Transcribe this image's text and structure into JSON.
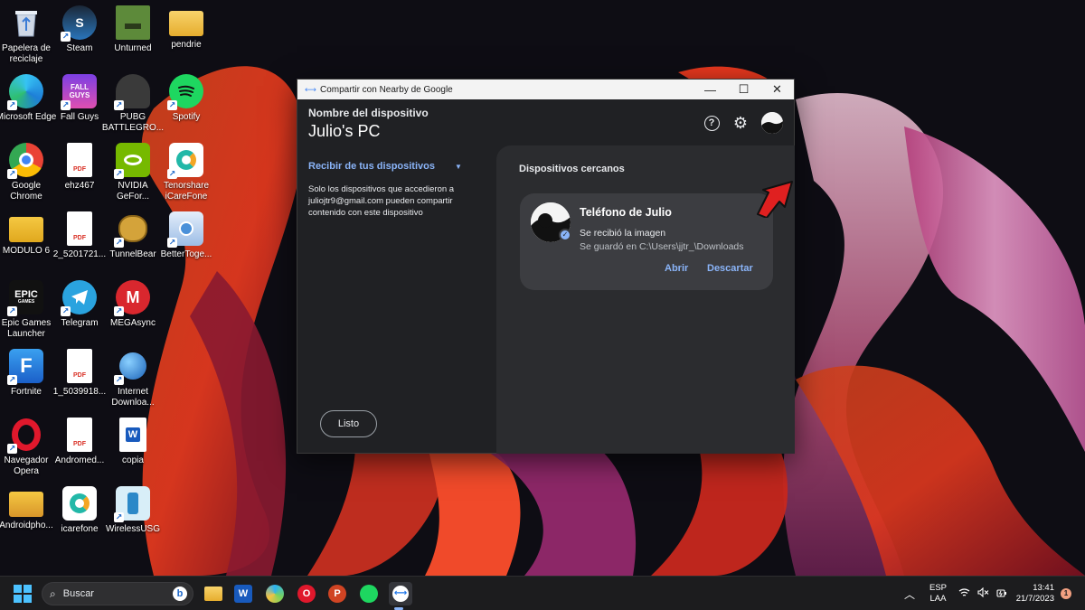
{
  "desktop": {
    "icons": [
      {
        "label": "Papelera de reciclaje",
        "icon": "recycle-bin-icon"
      },
      {
        "label": "Steam",
        "icon": "steam-icon"
      },
      {
        "label": "Unturned",
        "icon": "unturned-icon"
      },
      {
        "label": "pendrie",
        "icon": "folder-icon"
      },
      {
        "label": "Microsoft Edge",
        "icon": "edge-icon"
      },
      {
        "label": "Fall Guys",
        "icon": "fall-guys-icon"
      },
      {
        "label": "PUBG BATTLEGRO...",
        "icon": "pubg-icon"
      },
      {
        "label": "Spotify",
        "icon": "spotify-icon"
      },
      {
        "label": "Google Chrome",
        "icon": "chrome-icon"
      },
      {
        "label": "ehz467",
        "icon": "pdf-icon"
      },
      {
        "label": "NVIDIA GeFor...",
        "icon": "nvidia-icon"
      },
      {
        "label": "Tenorshare iCareFone",
        "icon": "icarefone-icon"
      },
      {
        "label": "MODULO 6",
        "icon": "folder-icon"
      },
      {
        "label": "2_5201721...",
        "icon": "pdf-icon"
      },
      {
        "label": "TunnelBear",
        "icon": "tunnelbear-icon"
      },
      {
        "label": "BetterToge...",
        "icon": "bettertogether-icon"
      },
      {
        "label": "Epic Games Launcher",
        "icon": "epic-games-icon"
      },
      {
        "label": "Telegram",
        "icon": "telegram-icon"
      },
      {
        "label": "MEGAsync",
        "icon": "mega-icon"
      },
      {
        "label": "Fortnite",
        "icon": "fortnite-icon"
      },
      {
        "label": "1_5039918...",
        "icon": "pdf-icon"
      },
      {
        "label": "Internet Downloa...",
        "icon": "idm-icon"
      },
      {
        "label": "Navegador Opera",
        "icon": "opera-icon"
      },
      {
        "label": "Andromed...",
        "icon": "pdf-icon"
      },
      {
        "label": "copia",
        "icon": "word-icon"
      },
      {
        "label": "Androidpho...",
        "icon": "folder-icon"
      },
      {
        "label": "icarefone",
        "icon": "icarefone-icon"
      },
      {
        "label": "WirelessUSG",
        "icon": "wirelessusg-icon"
      }
    ],
    "icon_text": {
      "pdf": "PDF",
      "epic": "EPIC",
      "epic_sub": "GAMES",
      "mega": "M",
      "fortnite": "F",
      "word": "W",
      "steam": "S",
      "fallguys": "FALL GUYS"
    }
  },
  "window": {
    "title": "Compartir con Nearby de Google",
    "controls": {
      "minimize": "—",
      "maximize": "☐",
      "close": "✕"
    },
    "device_name_label": "Nombre del dispositivo",
    "device_name": "Julio's PC",
    "help_icon": "?",
    "settings_icon": "⚙",
    "receive": {
      "label": "Recibir de tus dispositivos",
      "chevron": "▼",
      "description": "Solo los dispositivos que accedieron a juliojtr9@gmail.com pueden compartir contenido con este dispositivo"
    },
    "done_button": "Listo",
    "nearby": {
      "title": "Dispositivos cercanos",
      "device": {
        "name": "Teléfono de Julio",
        "status": "Se recibió la imagen",
        "saved_path": "Se guardó en C:\\Users\\jjtr_\\Downloads",
        "open": "Abrir",
        "dismiss": "Descartar",
        "check": "✓"
      }
    }
  },
  "taskbar": {
    "search_placeholder": "Buscar",
    "search_icon": "⌕",
    "bing_badge": "b",
    "apps": [
      "start-icon",
      "file-explorer-icon",
      "word-icon",
      "photos-icon",
      "opera-icon",
      "powerpoint-icon",
      "spotify-icon",
      "nearby-share-icon"
    ],
    "app_text": {
      "word": "W",
      "opera": "O",
      "powerpoint": "P"
    },
    "tray": {
      "chevron": "︿",
      "lang_top": "ESP",
      "lang_bottom": "LAA",
      "time": "13:41",
      "date": "21/7/2023",
      "notifications": "1"
    }
  },
  "colors": {
    "accent": "#8ab4f8",
    "window_bg": "#202124",
    "card_bg": "#3c3d41",
    "arrow": "#e02020"
  }
}
